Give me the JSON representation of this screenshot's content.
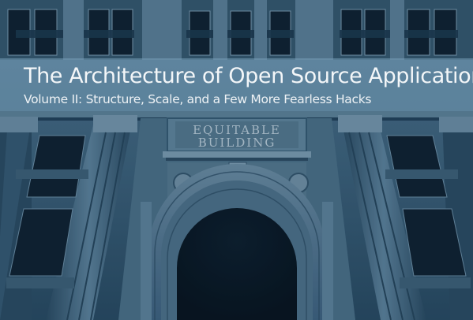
{
  "cover": {
    "title": "The Architecture of Open Source Applications",
    "subtitle": "Volume II: Structure, Scale, and a Few More Fearless Hacks"
  },
  "photo": {
    "sign_line1": "EQUITABLE",
    "sign_line2": "BUILDING",
    "palette": {
      "stone_light": "#6d8fa5",
      "stone_mid": "#3f6580",
      "stone_dark": "#1a3346",
      "window": "#0f2232",
      "arch_void": "#0a1826",
      "band": "#7aa0b8"
    }
  }
}
